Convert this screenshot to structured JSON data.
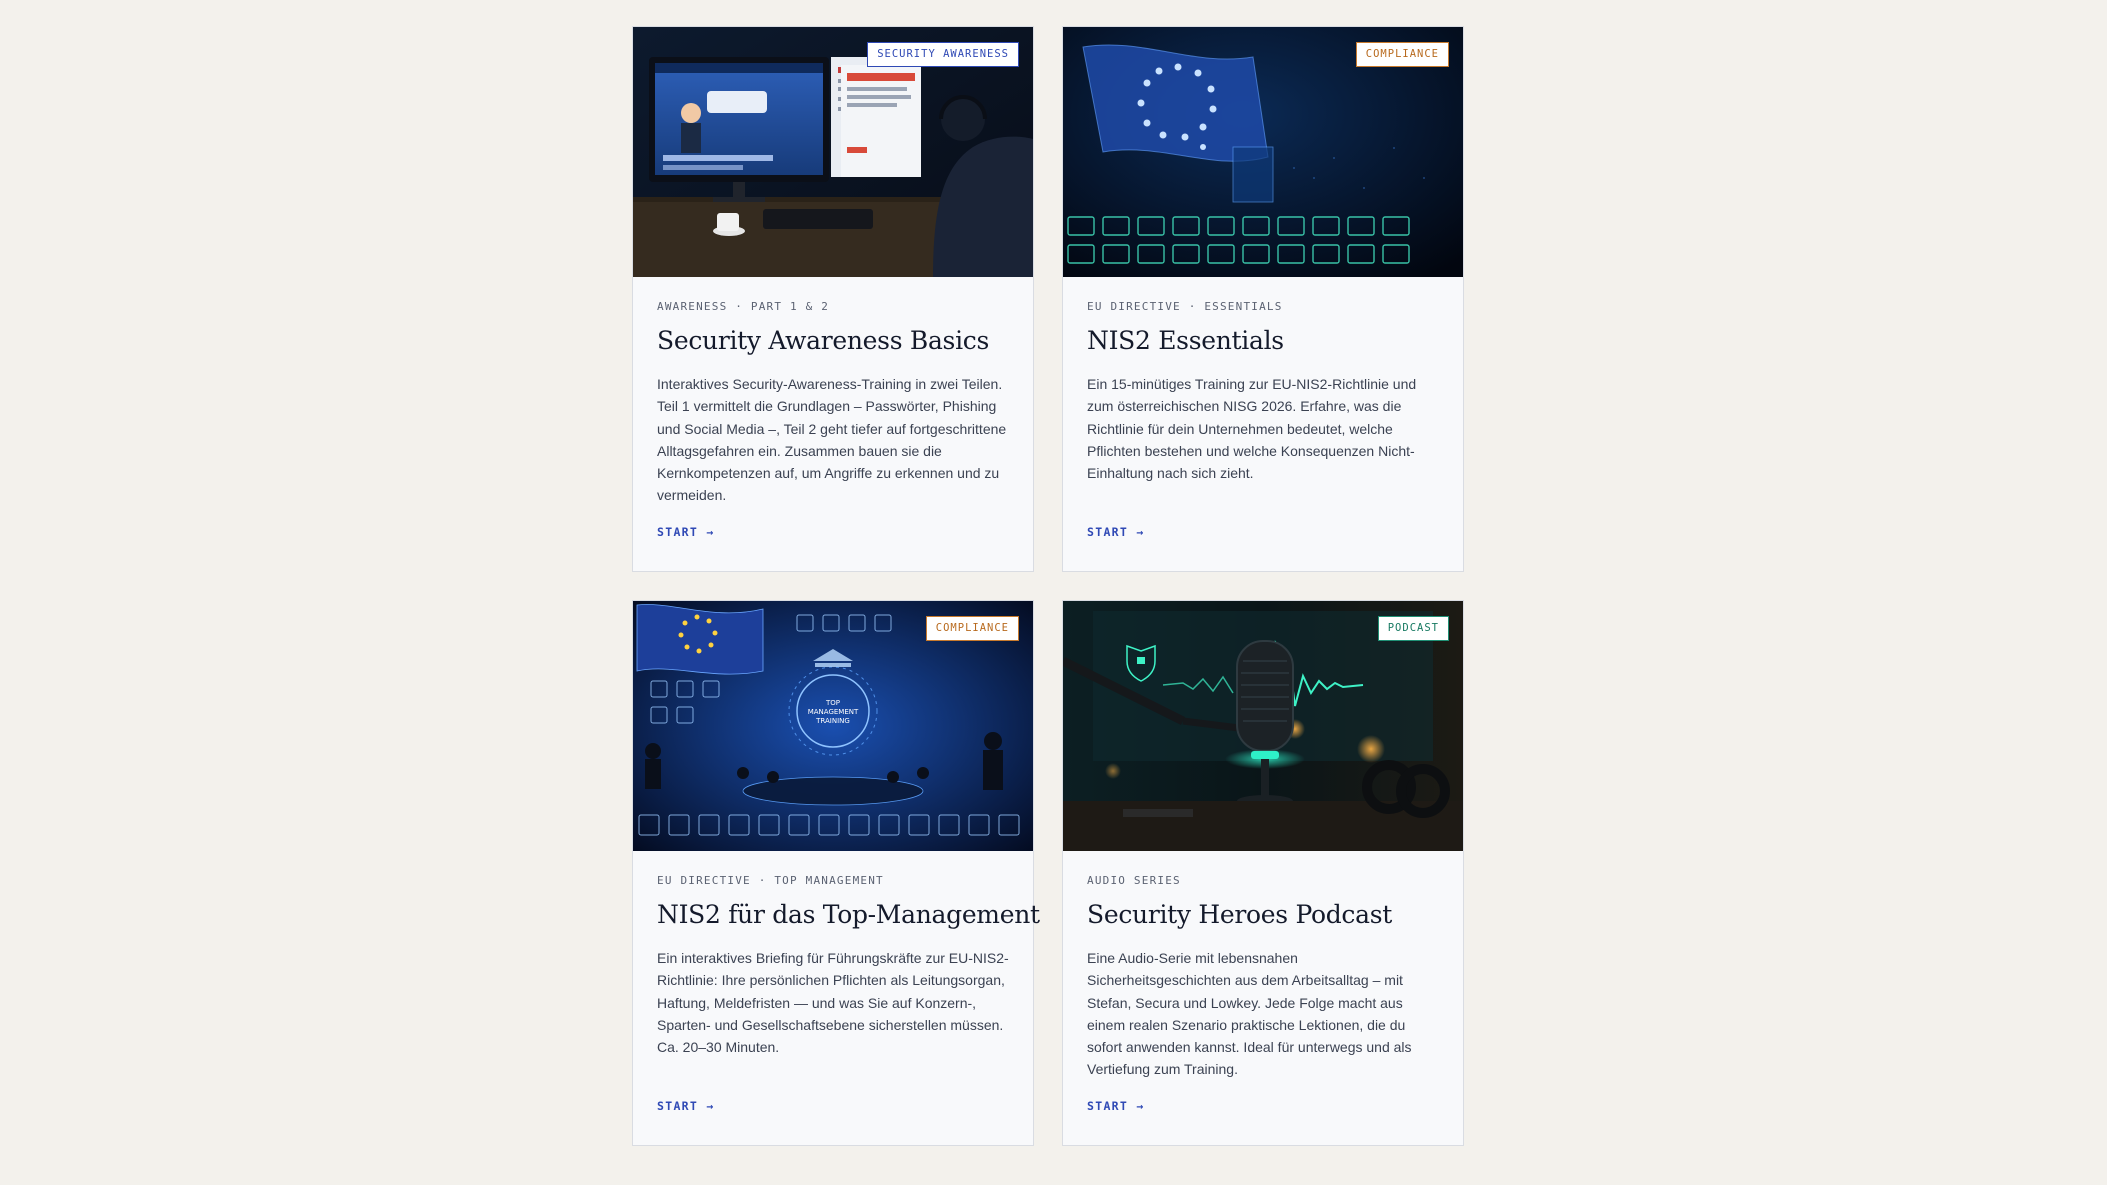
{
  "cards": [
    {
      "badge": "SECURITY AWARENESS",
      "meta": "AWARENESS · PART 1 & 2",
      "title": "Security Awareness Basics",
      "description": "Interaktives Security-Awareness-Training in zwei Teilen. Teil 1 vermittelt die Grundlagen – Passwörter, Phishing und Social Media –, Teil 2 geht tiefer auf fortgeschrittene Alltagsgefahren ein. Zusammen bauen sie die Kernkompetenzen auf, um Angriffe zu erkennen und zu vermeiden.",
      "cta": "START →",
      "image": "office-monitor-training-illustration"
    },
    {
      "badge": "COMPLIANCE",
      "meta": "EU DIRECTIVE · ESSENTIALS",
      "title": "NIS2 Essentials",
      "description": "Ein 15-minütiges Training zur EU-NIS2-Richtlinie und zum österreichischen NISG 2026. Erfahre, was die Richtlinie für dein Unternehmen bedeutet, welche Pflichten bestehen und welche Konsequenzen Nicht-Einhaltung nach sich zieht.",
      "cta": "START →",
      "image": "digital-eu-flag-illustration"
    },
    {
      "badge": "COMPLIANCE",
      "meta": "EU DIRECTIVE · TOP MANAGEMENT",
      "title": "NIS2 für das Top-Management",
      "description": "Ein interaktives Briefing für Führungskräfte zur EU-NIS2-Richtlinie: Ihre persönlichen Pflichten als Leitungsorgan, Haftung, Meldefristen — und was Sie auf Konzern-, Sparten- und Gesellschaftsebene sicherstellen müssen. Ca. 20–30 Minuten.",
      "cta": "START →",
      "image": "top-management-training-illustration",
      "image_text": [
        "TOP",
        "MANAGEMENT",
        "TRAINING"
      ]
    },
    {
      "badge": "PODCAST",
      "meta": "AUDIO SERIES",
      "title": "Security Heroes Podcast",
      "description": "Eine Audio-Serie mit lebensnahen Sicherheitsgeschichten aus dem Arbeitsalltag – mit Stefan, Secura und Lowkey. Jede Folge macht aus einem realen Szenario praktische Lektionen, die du sofort anwenden kannst. Ideal für unterwegs und als Vertiefung zum Training.",
      "cta": "START →",
      "image": "studio-microphone-illustration"
    }
  ],
  "colors": {
    "background": "#f3f1ec",
    "card": "#f8f9fb",
    "accent_blue": "#2f49b5",
    "compliance_orange": "#c7792c",
    "podcast_green": "#1f8f74"
  }
}
